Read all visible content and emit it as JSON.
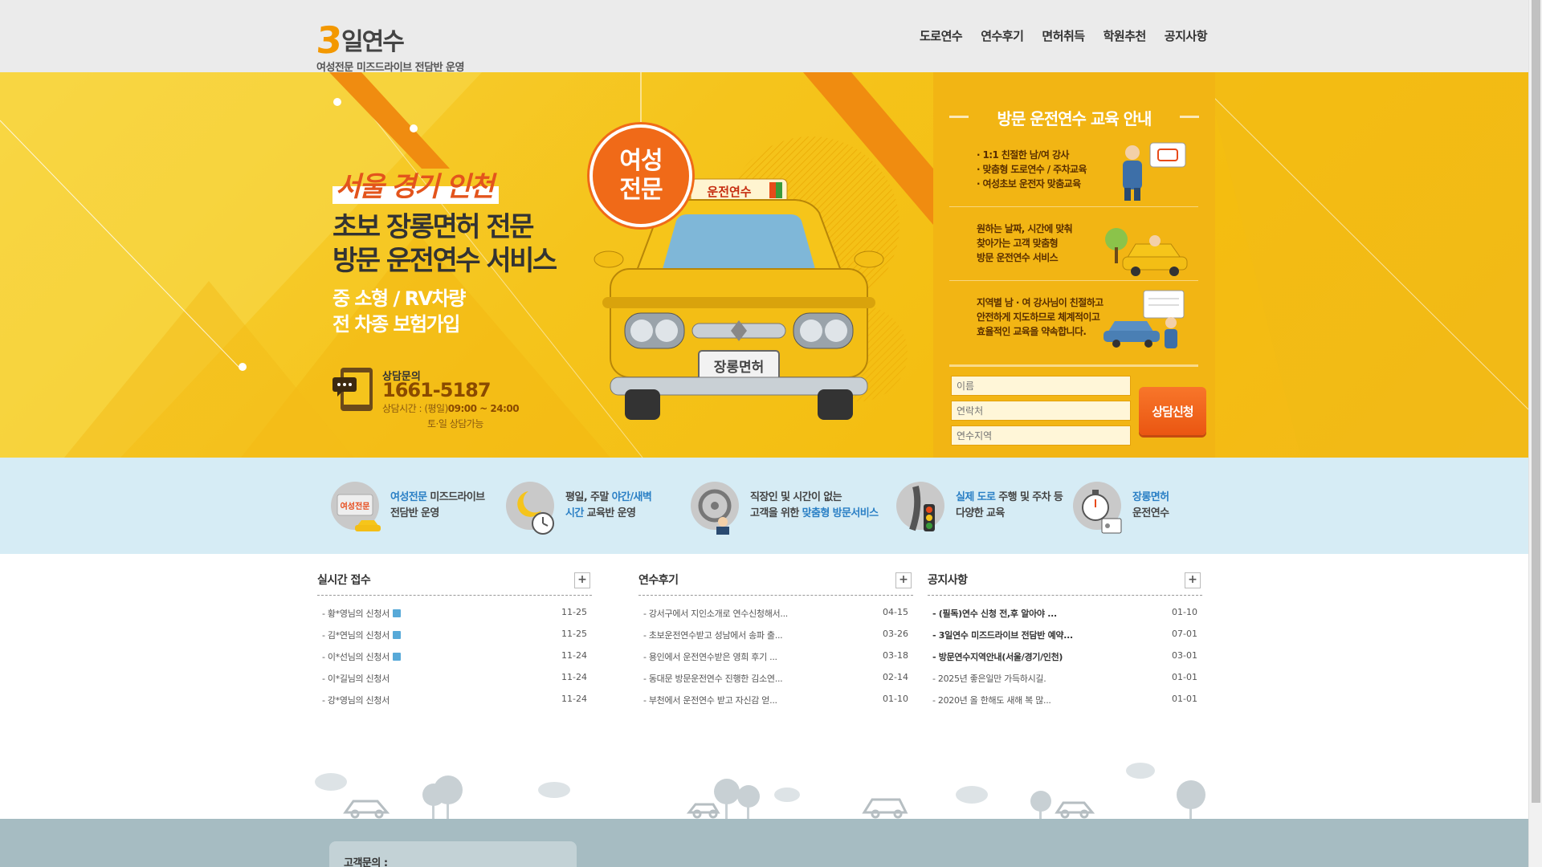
{
  "header": {
    "logo_num": "3",
    "logo_text": "일연수",
    "tagline": "여성전문 미즈드라이브 전담반 운영",
    "nav": [
      "도로연수",
      "연수후기",
      "면허취득",
      "학원추천",
      "공지사항"
    ]
  },
  "hero": {
    "region": "서울 경기 인천",
    "headline1": "초보 장롱면허 전문",
    "headline2": "방문 운전연수 서비스",
    "sub1": "중 소형 / RV차량",
    "sub2": "전 차종 보험가입",
    "badge_line1": "여성",
    "badge_line2": "전문",
    "car_sign": "운전연수",
    "plate": "장롱면허",
    "contact_label": "상담문의",
    "contact_number": "1661-5187",
    "hours_prefix": "상담시간 : (평일)",
    "hours_value": "09:00 ~ 24:00",
    "hours_weekend": "토·일 상담가능"
  },
  "info_panel": {
    "title": "방문 운전연수 교육 안내",
    "rows": [
      {
        "lines": [
          "· 1:1 친절한 남/여 강사",
          "· 맞춤형 도로연수 / 주차교육",
          "· 여성초보 운전자 맞춤교육"
        ]
      },
      {
        "lines": [
          "원하는 날짜, 시간에 맞춰",
          "찾아가는 고객 맞춤형",
          "방문 운전연수 서비스"
        ]
      },
      {
        "lines": [
          "지역별 남 · 여 강사님이 친절하고",
          "안전하게 지도하므로 체계적이고",
          "효율적인 교육을 약속합니다."
        ]
      }
    ],
    "form": {
      "name_placeholder": "이름",
      "phone_placeholder": "연락처",
      "region_placeholder": "연수지역",
      "submit_label": "상담신청"
    }
  },
  "features": [
    {
      "icon": "female-driver-icon",
      "hl": "여성전문",
      "rest1": " 미즈드라이브",
      "line2": "전담반 운영",
      "hl2": ""
    },
    {
      "icon": "moon-clock-icon",
      "pre": "평일, 주말 ",
      "hl": "야간/새벽",
      "line2_hl": "시간",
      "line2": " 교육반 운영"
    },
    {
      "icon": "steering-wheel-icon",
      "line1": "직장인 및 시간이 없는",
      "line2_pre": "고객을 위한 ",
      "line2_hl": "맞춤형 방문서비스"
    },
    {
      "icon": "traffic-light-icon",
      "hl": "실제 도로",
      "rest1": " 주행 및 주차 등",
      "line2": "다양한 교육"
    },
    {
      "icon": "stopwatch-license-icon",
      "hl": "장롱면허",
      "line2": "운전연수"
    }
  ],
  "boards": [
    {
      "title": "실시간 접수",
      "more": "+",
      "rows": [
        {
          "title": "- 황*영님의 신청서",
          "date": "11-25",
          "icon": true
        },
        {
          "title": "- 김*연님의 신청서",
          "date": "11-25",
          "icon": true
        },
        {
          "title": "- 이*선님의 신청서",
          "date": "11-24",
          "icon": true
        },
        {
          "title": "- 이*길님의 신청서",
          "date": "11-24",
          "icon": false
        },
        {
          "title": "- 강*영님의 신청서",
          "date": "11-24",
          "icon": false
        }
      ]
    },
    {
      "title": "연수후기",
      "more": "+",
      "rows": [
        {
          "title": "- 강서구에서 지인소개로 연수신청해서...",
          "date": "04-15"
        },
        {
          "title": "- 초보운전연수받고 성남에서 송파 출...",
          "date": "03-26"
        },
        {
          "title": "- 용인에서 운전연수받은 영희 후기 ...",
          "date": "03-18"
        },
        {
          "title": "- 동대문 방문운전연수 진행한 김소연...",
          "date": "02-14"
        },
        {
          "title": "- 부천에서 운전연수 받고 자신감 얻...",
          "date": "01-10"
        }
      ]
    },
    {
      "title": "공지사항",
      "more": "+",
      "rows": [
        {
          "title": "- (필독)연수 신청 전,후 알아야 ...",
          "date": "01-10",
          "bold": true
        },
        {
          "title": "- 3일연수 미즈드라이브 전담반 예약...",
          "date": "07-01",
          "bold": true
        },
        {
          "title": "- 방문연수지역안내(서울/경기/인천)",
          "date": "03-01",
          "bold": true
        },
        {
          "title": "- 2025년 좋은일만 가득하시길.",
          "date": "01-01",
          "bold": false
        },
        {
          "title": "- 2020년 올 한해도 새해 복 많...",
          "date": "01-01",
          "bold": false
        }
      ]
    }
  ],
  "footer": {
    "customer_label": "고객문의 :"
  },
  "colors": {
    "brand_orange": "#f39800",
    "hero_yellow": "#f5c41c",
    "accent_blue": "#2a7fc5",
    "feature_band": "#d6ecf5"
  }
}
